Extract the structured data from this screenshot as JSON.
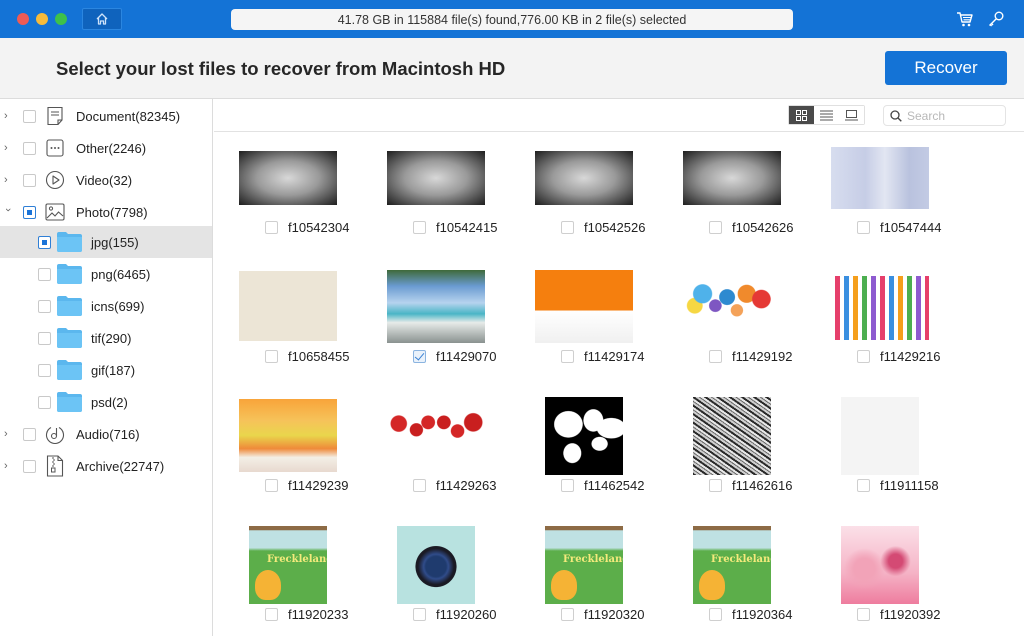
{
  "titlebar": {
    "status": "41.78 GB in 115884 file(s) found,776.00 KB in 2 file(s) selected",
    "icons": {
      "home": "home-icon",
      "cart": "cart-icon",
      "key": "key-icon"
    }
  },
  "header": {
    "title": "Select your lost files to recover from Macintosh HD",
    "recover_label": "Recover",
    "accent": "#1473d6"
  },
  "sidebar": {
    "categories": [
      {
        "label": "Document(82345)",
        "icon": "document-icon",
        "expanded": false,
        "state": "unchecked"
      },
      {
        "label": "Other(2246)",
        "icon": "other-icon",
        "expanded": false,
        "state": "unchecked"
      },
      {
        "label": "Video(32)",
        "icon": "video-icon",
        "expanded": false,
        "state": "unchecked"
      },
      {
        "label": "Photo(7798)",
        "icon": "photo-icon",
        "expanded": true,
        "state": "partial"
      },
      {
        "label": "Audio(716)",
        "icon": "audio-icon",
        "expanded": false,
        "state": "unchecked"
      },
      {
        "label": "Archive(22747)",
        "icon": "archive-icon",
        "expanded": false,
        "state": "unchecked"
      }
    ],
    "photo_subfolders": [
      {
        "label": "jpg(155)",
        "state": "partial",
        "selected": true
      },
      {
        "label": "png(6465)",
        "state": "unchecked",
        "selected": false
      },
      {
        "label": "icns(699)",
        "state": "unchecked",
        "selected": false
      },
      {
        "label": "tif(290)",
        "state": "unchecked",
        "selected": false
      },
      {
        "label": "gif(187)",
        "state": "unchecked",
        "selected": false
      },
      {
        "label": "psd(2)",
        "state": "unchecked",
        "selected": false
      }
    ]
  },
  "toolbar": {
    "views": [
      "grid-view",
      "list-view",
      "preview-view"
    ],
    "active_view": "grid-view",
    "search_placeholder": "Search",
    "search_value": ""
  },
  "files": [
    {
      "name": "f10542304",
      "checked": false,
      "thumb": "grunge"
    },
    {
      "name": "f10542415",
      "checked": false,
      "thumb": "grunge"
    },
    {
      "name": "f10542526",
      "checked": false,
      "thumb": "grunge"
    },
    {
      "name": "f10542626",
      "checked": false,
      "thumb": "grunge"
    },
    {
      "name": "f10547444",
      "checked": false,
      "thumb": "silver"
    },
    {
      "name": "f10658455",
      "checked": false,
      "thumb": "paper"
    },
    {
      "name": "f11429070",
      "checked": true,
      "thumb": "beach"
    },
    {
      "name": "f11429174",
      "checked": false,
      "thumb": "cake"
    },
    {
      "name": "f11429192",
      "checked": false,
      "thumb": "balloons"
    },
    {
      "name": "f11429216",
      "checked": false,
      "thumb": "candles"
    },
    {
      "name": "f11429239",
      "checked": false,
      "thumb": "candles-warm"
    },
    {
      "name": "f11429263",
      "checked": false,
      "thumb": "red-balloons"
    },
    {
      "name": "f11462542",
      "checked": false,
      "thumb": "world-map"
    },
    {
      "name": "f11462616",
      "checked": false,
      "thumb": "noise"
    },
    {
      "name": "f11911158",
      "checked": false,
      "thumb": "white-texture"
    },
    {
      "name": "f11920233",
      "checked": false,
      "thumb": "freckleland"
    },
    {
      "name": "f11920260",
      "checked": false,
      "thumb": "globe"
    },
    {
      "name": "f11920320",
      "checked": false,
      "thumb": "freckleland"
    },
    {
      "name": "f11920364",
      "checked": false,
      "thumb": "freckleland"
    },
    {
      "name": "f11920392",
      "checked": false,
      "thumb": "pink-watercolor"
    }
  ],
  "thumb_text": {
    "freckleland": "Freckleland"
  }
}
